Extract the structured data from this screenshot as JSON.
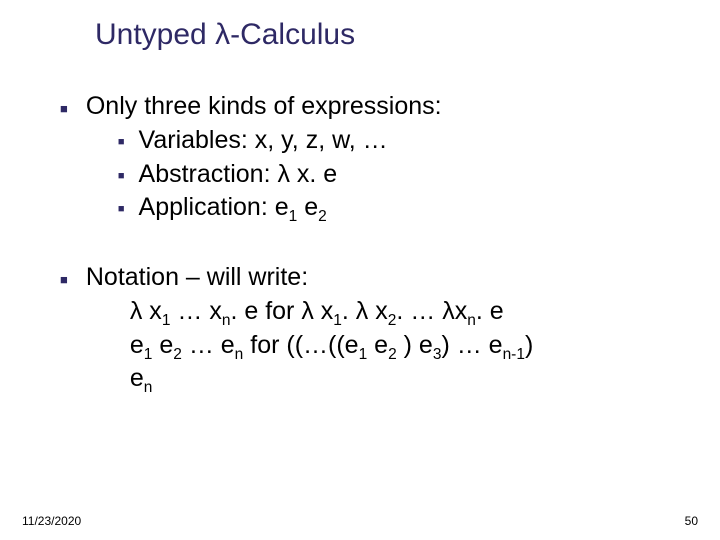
{
  "title": "Untyped λ-Calculus",
  "kinds": {
    "lead": "Only three kinds of expressions:",
    "items": {
      "variables": "Variables: x, y, z, w, …",
      "abstraction": "Abstraction:  λ x. e",
      "application_prefix": "Application:  e",
      "application_mid": " e"
    }
  },
  "notation": {
    "lead": "Notation – will write:",
    "line1_a": "λ x",
    "line1_b": " … x",
    "line1_c": ". e for λ x",
    "line1_d": ". λ x",
    "line1_e": ". … λx",
    "line1_f": ". e",
    "line2_a": "e",
    "line2_b": " e",
    "line2_c": " … e",
    "line2_d": "  for ((…((e",
    "line2_e": " e",
    "line2_f": " ) e",
    "line2_g": ") … e",
    "line2_h": ")",
    "line3_a": "e"
  },
  "sub": {
    "1": "1",
    "2": "2",
    "3": "3",
    "n": "n",
    "nm1": "n-1"
  },
  "footer": {
    "date": "11/23/2020",
    "page": "50"
  }
}
